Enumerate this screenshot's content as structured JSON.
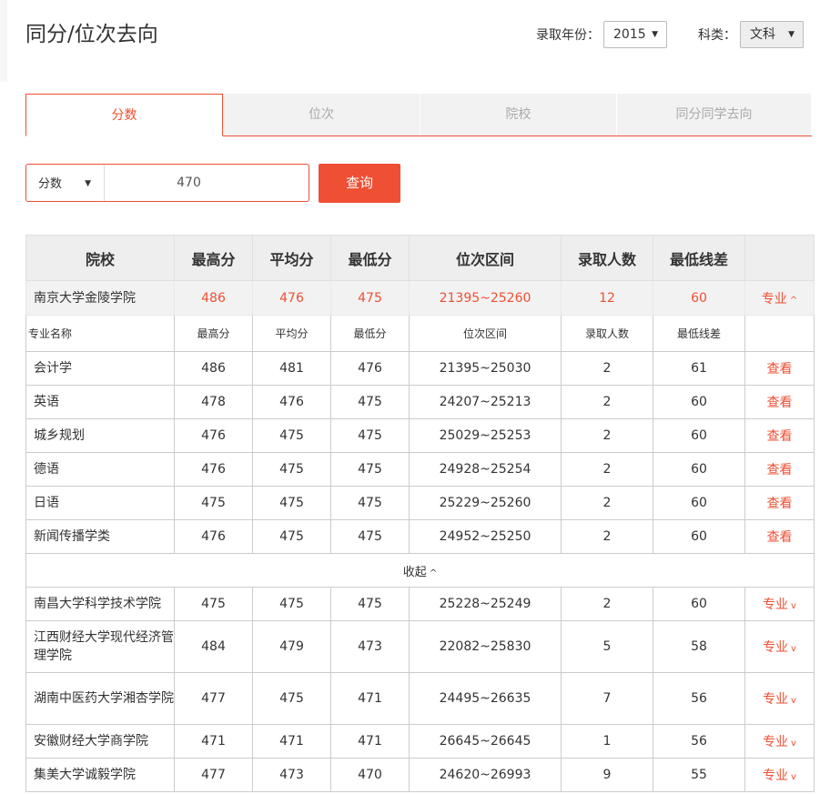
{
  "page": {
    "title": "同分/位次去向",
    "year_label": "录取年份：",
    "year_value": "2015",
    "subject_label": "科类：",
    "subject_value": "文科"
  },
  "tabs": [
    {
      "label": "分数",
      "active": true
    },
    {
      "label": "位次",
      "active": false
    },
    {
      "label": "院校",
      "active": false
    },
    {
      "label": "同分同学去向",
      "active": false
    }
  ],
  "search": {
    "type_label": "分数",
    "value": "470",
    "button_label": "查询"
  },
  "table": {
    "headers": [
      "院校",
      "最高分",
      "平均分",
      "最低分",
      "位次区间",
      "录取人数",
      "最低线差",
      ""
    ],
    "expanded_school": {
      "name": "南京大学金陵学院",
      "max": "486",
      "avg": "476",
      "min": "475",
      "rank": "21395~25260",
      "count": "12",
      "diff": "60",
      "action": "专业",
      "action_arrow": "^"
    },
    "sub_headers": [
      "专业名称",
      "最高分",
      "平均分",
      "最低分",
      "位次区间",
      "录取人数",
      "最低线差",
      ""
    ],
    "majors": [
      {
        "name": "会计学",
        "max": "486",
        "avg": "481",
        "min": "476",
        "rank": "21395~25030",
        "count": "2",
        "diff": "61",
        "action": "查看"
      },
      {
        "name": "英语",
        "max": "478",
        "avg": "476",
        "min": "475",
        "rank": "24207~25213",
        "count": "2",
        "diff": "60",
        "action": "查看"
      },
      {
        "name": "城乡规划",
        "max": "476",
        "avg": "475",
        "min": "475",
        "rank": "25029~25253",
        "count": "2",
        "diff": "60",
        "action": "查看"
      },
      {
        "name": "德语",
        "max": "476",
        "avg": "475",
        "min": "475",
        "rank": "24928~25254",
        "count": "2",
        "diff": "60",
        "action": "查看"
      },
      {
        "name": "日语",
        "max": "475",
        "avg": "475",
        "min": "475",
        "rank": "25229~25260",
        "count": "2",
        "diff": "60",
        "action": "查看"
      },
      {
        "name": "新闻传播学类",
        "max": "476",
        "avg": "475",
        "min": "475",
        "rank": "24952~25250",
        "count": "2",
        "diff": "60",
        "action": "查看"
      }
    ],
    "collapse_label": "收起",
    "collapse_arrow": "^",
    "schools": [
      {
        "name": "南昌大学科学技术学院",
        "max": "475",
        "avg": "475",
        "min": "475",
        "rank": "25228~25249",
        "count": "2",
        "diff": "60",
        "action": "专业",
        "arrow": "v"
      },
      {
        "name": "江西财经大学现代经济管理学院",
        "max": "484",
        "avg": "479",
        "min": "473",
        "rank": "22082~25830",
        "count": "5",
        "diff": "58",
        "action": "专业",
        "arrow": "v"
      },
      {
        "name": "湖南中医药大学湘杏学院",
        "max": "477",
        "avg": "475",
        "min": "471",
        "rank": "24495~26635",
        "count": "7",
        "diff": "56",
        "action": "专业",
        "arrow": "v"
      },
      {
        "name": "安徽财经大学商学院",
        "max": "471",
        "avg": "471",
        "min": "471",
        "rank": "26645~26645",
        "count": "1",
        "diff": "56",
        "action": "专业",
        "arrow": "v"
      },
      {
        "name": "集美大学诚毅学院",
        "max": "477",
        "avg": "473",
        "min": "470",
        "rank": "24620~26993",
        "count": "9",
        "diff": "55",
        "action": "专业",
        "arrow": "v"
      }
    ]
  }
}
